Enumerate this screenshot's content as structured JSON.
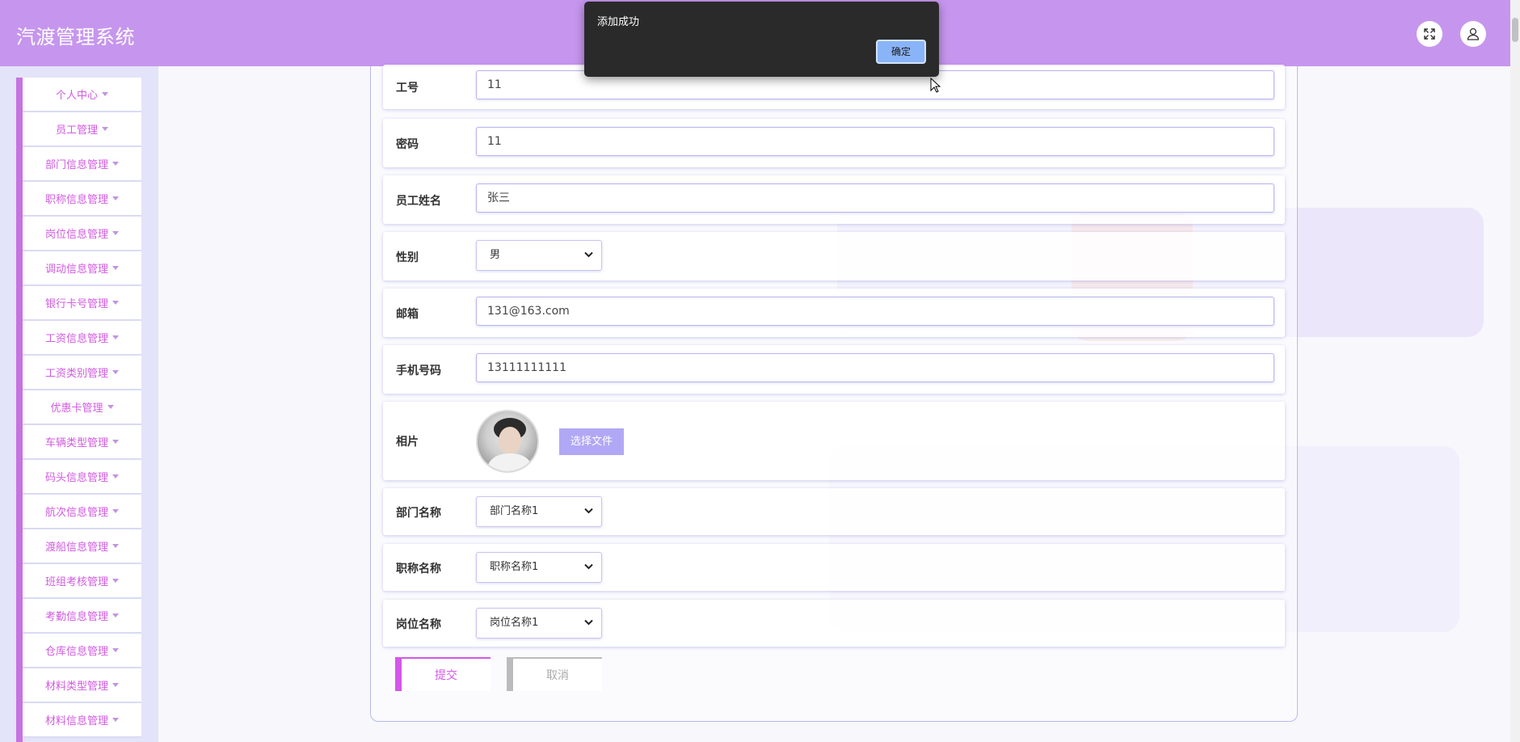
{
  "app": {
    "title": "汽渡管理系统"
  },
  "header": {
    "fullscreen_icon": "expand-icon",
    "user_icon": "user-icon"
  },
  "sidebar": {
    "items": [
      {
        "label": "个人中心"
      },
      {
        "label": "员工管理"
      },
      {
        "label": "部门信息管理"
      },
      {
        "label": "职称信息管理"
      },
      {
        "label": "岗位信息管理"
      },
      {
        "label": "调动信息管理"
      },
      {
        "label": "银行卡号管理"
      },
      {
        "label": "工资信息管理"
      },
      {
        "label": "工资类别管理"
      },
      {
        "label": "优惠卡管理"
      },
      {
        "label": "车辆类型管理"
      },
      {
        "label": "码头信息管理"
      },
      {
        "label": "航次信息管理"
      },
      {
        "label": "渡船信息管理"
      },
      {
        "label": "班组考核管理"
      },
      {
        "label": "考勤信息管理"
      },
      {
        "label": "仓库信息管理"
      },
      {
        "label": "材料类型管理"
      },
      {
        "label": "材料信息管理"
      }
    ]
  },
  "form": {
    "employee_id": {
      "label": "工号",
      "value": "11"
    },
    "password": {
      "label": "密码",
      "value": "11"
    },
    "name": {
      "label": "员工姓名",
      "value": "张三"
    },
    "gender": {
      "label": "性别",
      "value": "男"
    },
    "email": {
      "label": "邮箱",
      "value": "131@163.com"
    },
    "phone": {
      "label": "手机号码",
      "value": "13111111111"
    },
    "photo": {
      "label": "相片",
      "button": "选择文件"
    },
    "department": {
      "label": "部门名称",
      "value": "部门名称1"
    },
    "title": {
      "label": "职称名称",
      "value": "职称名称1"
    },
    "position": {
      "label": "岗位名称",
      "value": "岗位名称1"
    },
    "submit": "提交",
    "cancel": "取消"
  },
  "dialog": {
    "message": "添加成功",
    "ok": "确定"
  },
  "colors": {
    "header": "#c696ee",
    "accent": "#d457ea",
    "sidebar_border": "#c772e0"
  }
}
